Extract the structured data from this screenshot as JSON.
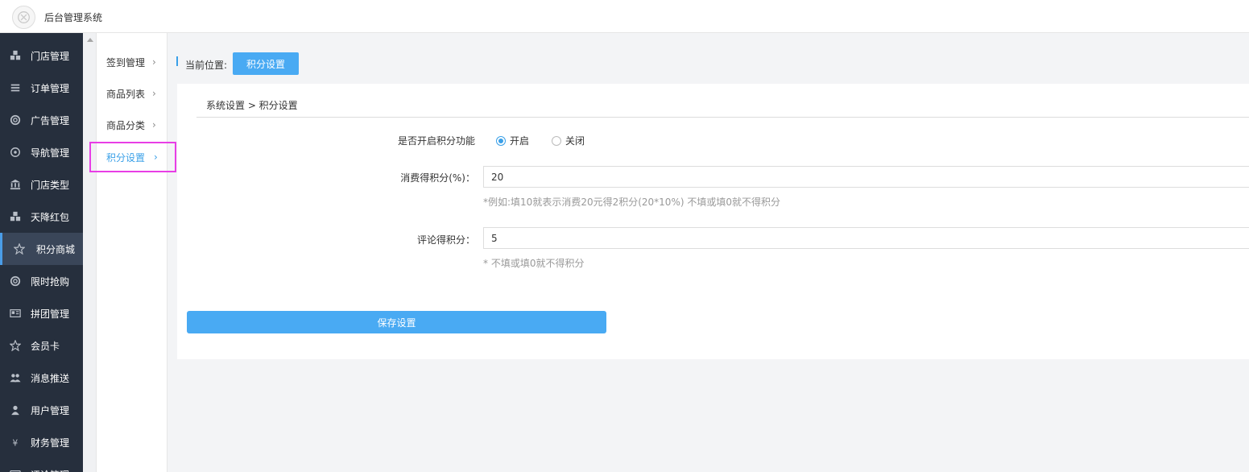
{
  "header": {
    "title": "后台管理系统"
  },
  "sidebar": {
    "items": [
      {
        "label": "门店管理",
        "icon": "cubes-icon"
      },
      {
        "label": "订单管理",
        "icon": "list-icon"
      },
      {
        "label": "广告管理",
        "icon": "lifebuoy-icon"
      },
      {
        "label": "导航管理",
        "icon": "compass-icon"
      },
      {
        "label": "门店类型",
        "icon": "bank-icon"
      },
      {
        "label": "天降红包",
        "icon": "cubes-icon"
      },
      {
        "label": "积分商城",
        "icon": "star-icon",
        "active": true
      },
      {
        "label": "限时抢购",
        "icon": "lifebuoy-icon"
      },
      {
        "label": "拼团管理",
        "icon": "newspaper-icon"
      },
      {
        "label": "会员卡",
        "icon": "star-icon"
      },
      {
        "label": "消息推送",
        "icon": "users-icon"
      },
      {
        "label": "用户管理",
        "icon": "user-icon"
      },
      {
        "label": "财务管理",
        "icon": "yen-icon"
      },
      {
        "label": "评论管理",
        "icon": "comment-icon"
      }
    ]
  },
  "subnav": {
    "items": [
      {
        "label": "签到管理"
      },
      {
        "label": "商品列表"
      },
      {
        "label": "商品分类"
      },
      {
        "label": "积分设置",
        "active": true
      }
    ],
    "chevron": "›"
  },
  "location": {
    "label": "当前位置:",
    "current": "积分设置"
  },
  "panel": {
    "breadcrumb": "系统设置 > 积分设置",
    "enable": {
      "label": "是否开启积分功能",
      "options": [
        {
          "label": "开启",
          "checked": true
        },
        {
          "label": "关闭",
          "checked": false
        }
      ]
    },
    "consume": {
      "label": "消费得积分(%)：",
      "value": "20",
      "hint": "*例如:填10就表示消费20元得2积分(20*10%) 不填或填0就不得积分"
    },
    "comment": {
      "label": "评论得积分：",
      "value": "5",
      "hint": "* 不填或填0就不得积分"
    },
    "save_label": "保存设置"
  },
  "colors": {
    "accent": "#49aaf3",
    "sidebar_bg": "#262f3d",
    "highlight": "#e83ee6"
  }
}
